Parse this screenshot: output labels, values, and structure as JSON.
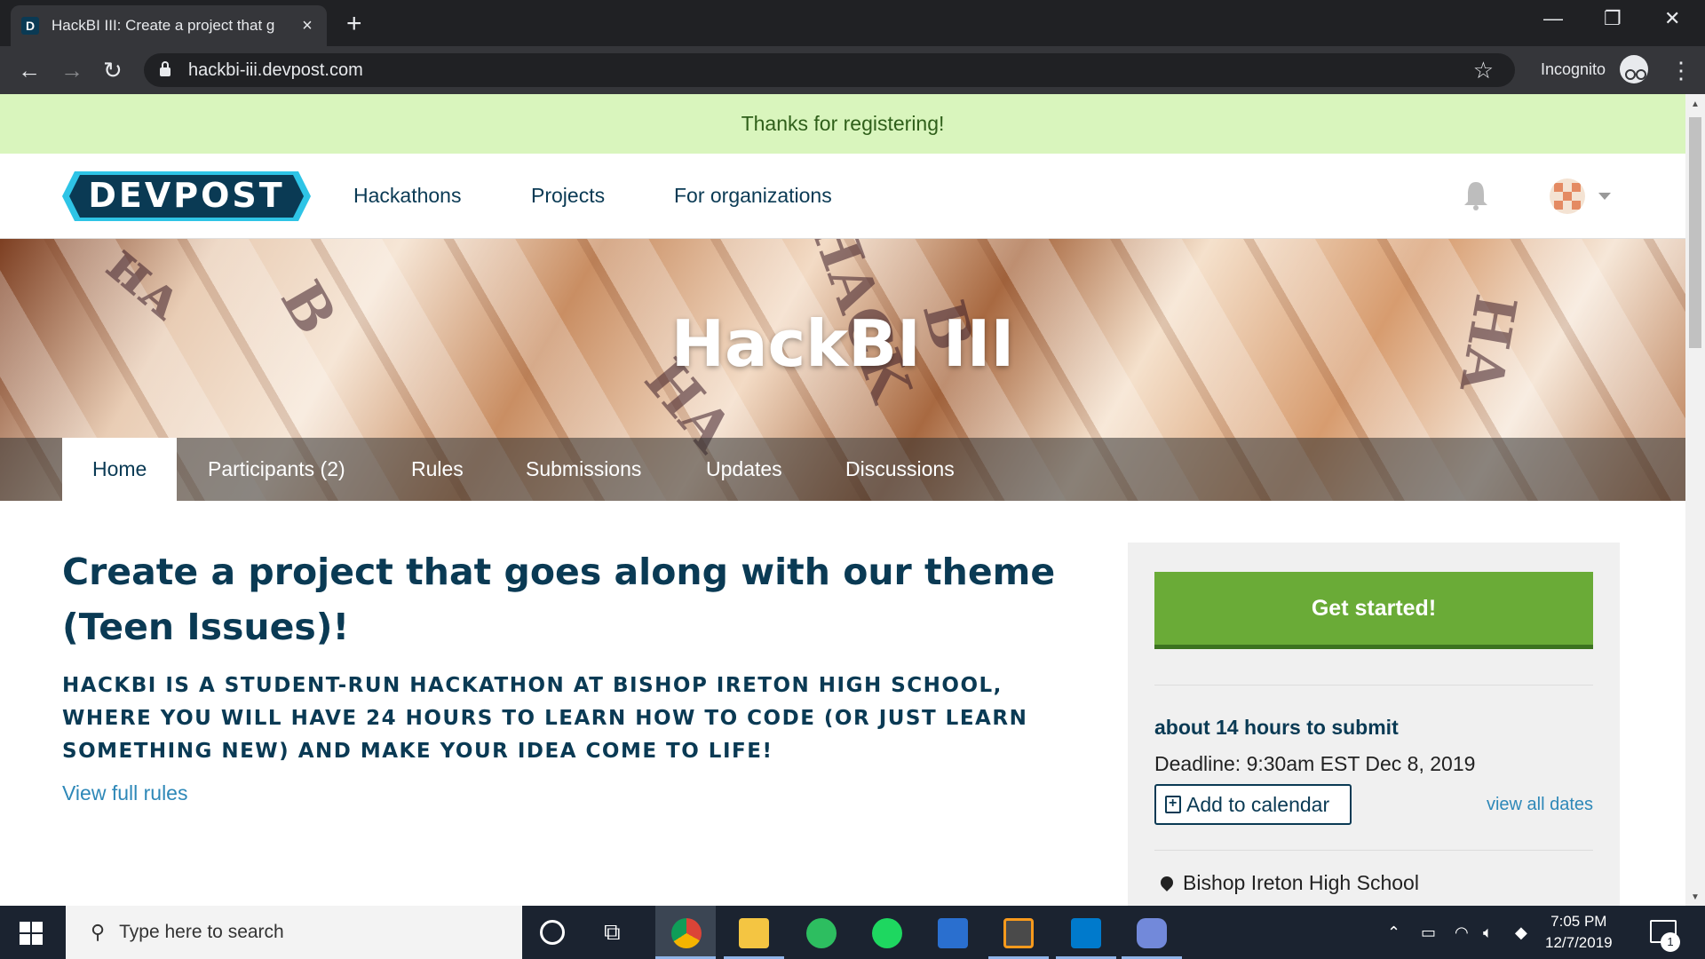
{
  "browser": {
    "tab_title": "HackBI III: Create a project that g",
    "tab_favicon": "D",
    "url": "hackbi-iii.devpost.com",
    "incognito_label": "Incognito"
  },
  "notice": "Thanks for registering!",
  "site_nav": {
    "logo_text": "DEVPOST",
    "links": [
      "Hackathons",
      "Projects",
      "For organizations"
    ]
  },
  "banner": {
    "title": "HackBI III",
    "tabs": [
      "Home",
      "Participants (2)",
      "Rules",
      "Submissions",
      "Updates",
      "Discussions"
    ]
  },
  "main": {
    "heading": "Create a project that goes along with our theme (Teen Issues)!",
    "tagline": "HackBI is a student-run hackathon at Bishop Ireton High School, where you will have 24 hours to learn how to code (or just learn something new) and make your idea come to life!",
    "rules_link": "View full rules"
  },
  "sidebar": {
    "cta": "Get started!",
    "time_left": "about 14 hours to submit",
    "deadline": "Deadline: 9:30am EST Dec 8, 2019",
    "calendar_btn": "Add to calendar",
    "view_dates": "view all dates",
    "location": "Bishop Ireton High School"
  },
  "taskbar": {
    "search_placeholder": "Type here to search",
    "time": "7:05 PM",
    "date": "12/7/2019",
    "notification_count": "1"
  },
  "colors": {
    "brand_dark": "#0a3a54",
    "brand_cyan": "#2ec4e6",
    "cta_green": "#6aab37",
    "notice_bg": "#d9f5bd",
    "link_blue": "#2e88b8"
  }
}
